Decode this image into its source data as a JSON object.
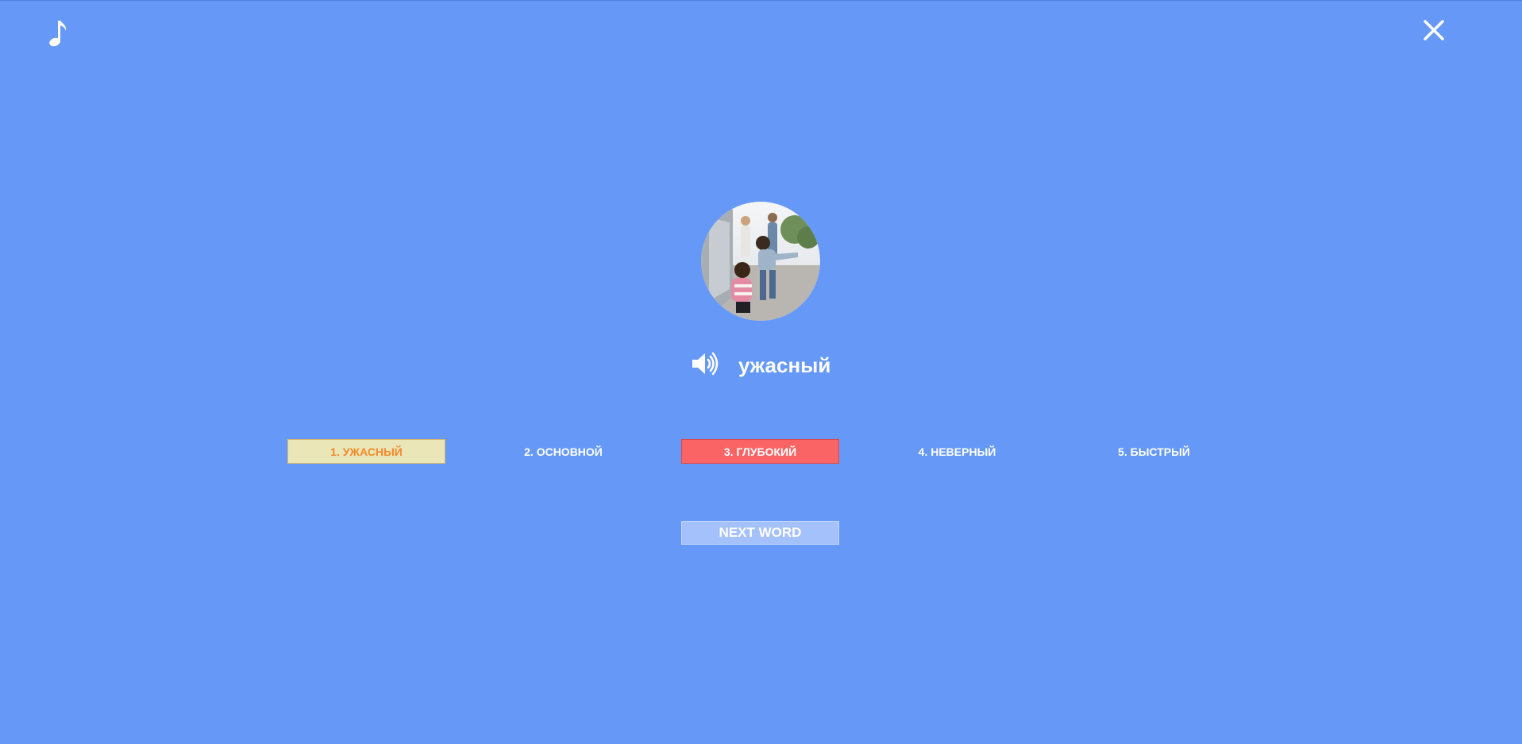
{
  "icons": {
    "music": "music-note-icon",
    "close": "close-icon",
    "speaker": "speaker-icon"
  },
  "word": {
    "text": "ужасный",
    "image_alt": "children in a schoolyard"
  },
  "options": [
    {
      "label": "1. УЖАСНЫЙ",
      "state": "correct"
    },
    {
      "label": "2. ОСНОВНОЙ",
      "state": "neutral"
    },
    {
      "label": "3. ГЛУБОКИЙ",
      "state": "wrong"
    },
    {
      "label": "4. НЕВЕРНЫЙ",
      "state": "neutral"
    },
    {
      "label": "5. БЫСТРЫЙ",
      "state": "neutral"
    }
  ],
  "next_button": {
    "label": "NEXT WORD"
  },
  "colors": {
    "background": "#6699f7",
    "correct_fill": "#ebe6b7",
    "correct_text": "#f08a2c",
    "wrong_fill": "#fb6464",
    "next_fill": "#a4c1fb"
  }
}
